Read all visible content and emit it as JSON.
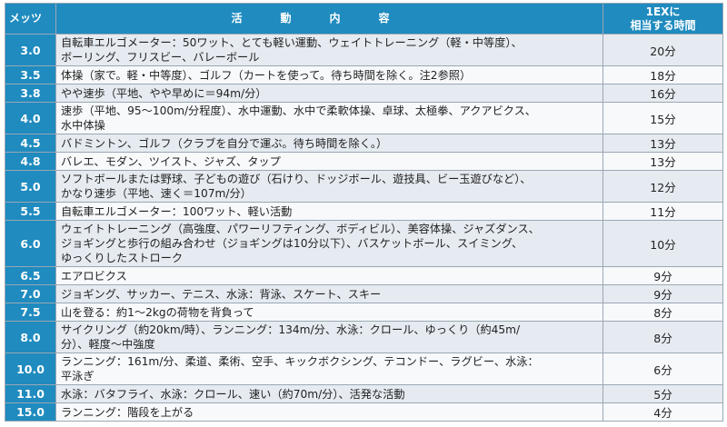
{
  "header": {
    "mets": "メッツ",
    "activity": "活動内容",
    "time_line1": "1EXに",
    "time_line2": "相当する時間"
  },
  "rows": [
    {
      "mets": "3.0",
      "lines": [
        "自転車エルゴメーター：50ワット、とても軽い運動、ウェイトトレーニング（軽・中等度）、",
        "ボーリング、フリスビー、バレーボール"
      ],
      "time": "20分"
    },
    {
      "mets": "3.5",
      "lines": [
        "体操（家で。軽・中等度）、ゴルフ（カートを使って。待ち時間を除く。注2参照）"
      ],
      "time": "18分"
    },
    {
      "mets": "3.8",
      "lines": [
        "やや速歩（平地、やや早めに＝94m/分）"
      ],
      "time": "16分"
    },
    {
      "mets": "4.0",
      "lines": [
        "速歩（平地、95～100m/分程度）、水中運動、水中で柔軟体操、卓球、太極拳、アクアビクス、",
        "水中体操"
      ],
      "time": "15分"
    },
    {
      "mets": "4.5",
      "lines": [
        "バドミントン、ゴルフ（クラブを自分で運ぶ。待ち時間を除く。）"
      ],
      "time": "13分"
    },
    {
      "mets": "4.8",
      "lines": [
        "バレエ、モダン、ツイスト、ジャズ、タップ"
      ],
      "time": "13分"
    },
    {
      "mets": "5.0",
      "lines": [
        "ソフトボールまたは野球、子どもの遊び（石けり、ドッジボール、遊技具、ビー玉遊びなど）、",
        "かなり速歩（平地、速く＝107m/分）"
      ],
      "time": "12分"
    },
    {
      "mets": "5.5",
      "lines": [
        "自転車エルゴメーター：100ワット、軽い活動"
      ],
      "time": "11分"
    },
    {
      "mets": "6.0",
      "lines": [
        "ウェイトトレーニング（高強度、パワーリフティング、ボディビル）、美容体操、ジャズダンス、",
        "ジョギングと歩行の組み合わせ（ジョギングは10分以下）、バスケットボール、スイミング、",
        "ゆっくりしたストローク"
      ],
      "time": "10分"
    },
    {
      "mets": "6.5",
      "lines": [
        "エアロビクス"
      ],
      "time": "9分"
    },
    {
      "mets": "7.0",
      "lines": [
        "ジョギング、サッカー、テニス、水泳：背泳、スケート、スキー"
      ],
      "time": "9分"
    },
    {
      "mets": "7.5",
      "lines": [
        "山を登る：約1～2kgの荷物を背負って"
      ],
      "time": "8分"
    },
    {
      "mets": "8.0",
      "lines": [
        "サイクリング（約20km/時）、ランニング：134m/分、水泳：クロール、ゆっくり（約45m/",
        "分）、軽度～中強度"
      ],
      "time": "8分"
    },
    {
      "mets": "10.0",
      "lines": [
        "ランニング：161m/分、柔道、柔術、空手、キックボクシング、テコンドー、ラグビー、水泳：",
        "平泳ぎ"
      ],
      "time": "6分"
    },
    {
      "mets": "11.0",
      "lines": [
        "水泳：バタフライ、水泳：クロール、速い（約70m/分）、活発な活動"
      ],
      "time": "5分"
    },
    {
      "mets": "15.0",
      "lines": [
        "ランニング：階段を上がる"
      ],
      "time": "4分"
    }
  ]
}
